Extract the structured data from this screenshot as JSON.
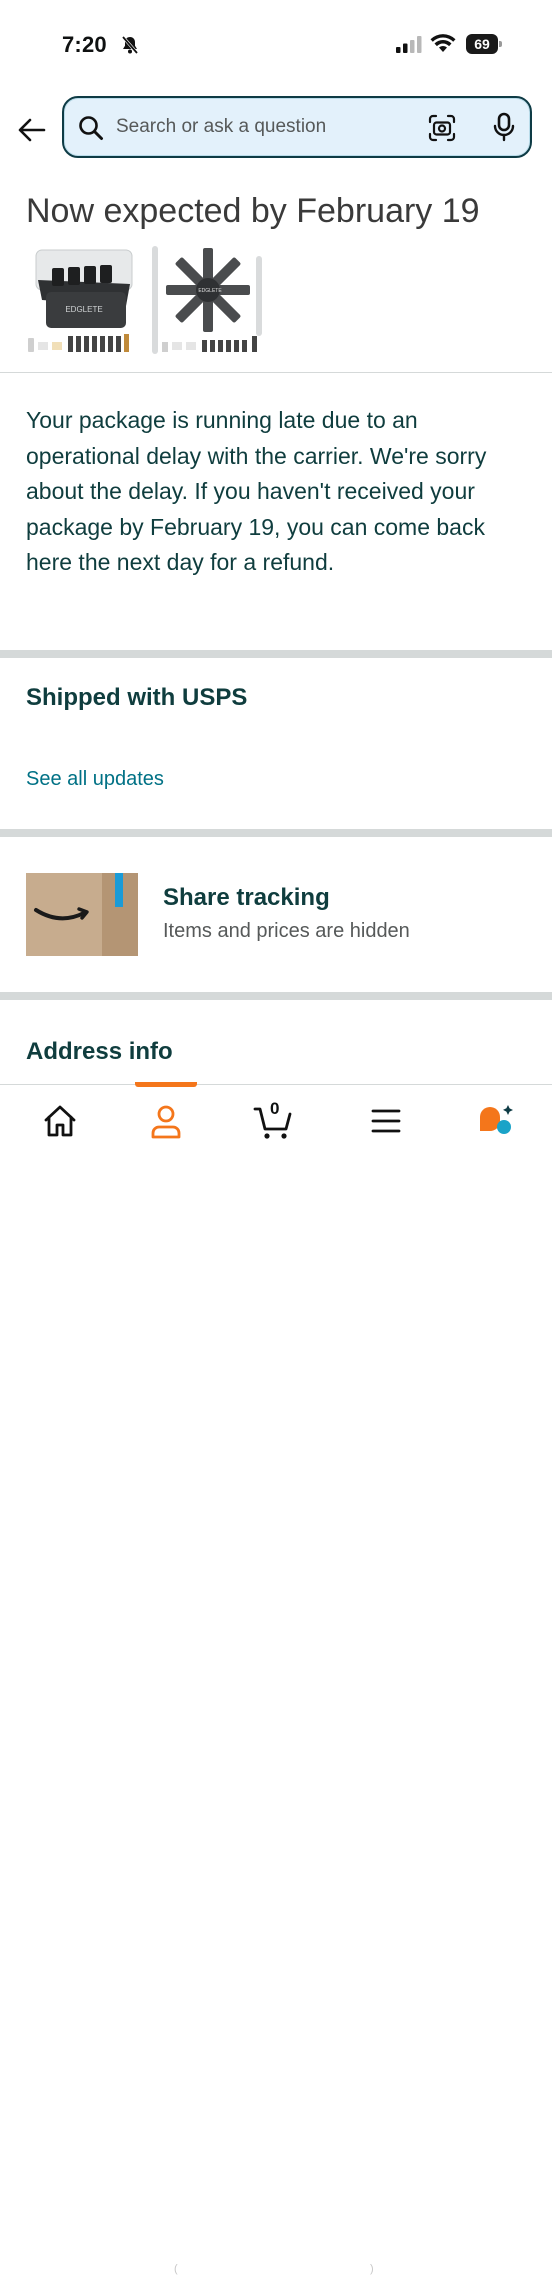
{
  "status_bar": {
    "time": "7:20",
    "battery": "69"
  },
  "search": {
    "placeholder": "Search or ask a question"
  },
  "delivery": {
    "title": "Now expected by February 19",
    "message": "Your package is running late due to an operational delay with the carrier. We're sorry about the delay. If you haven't received your package by February 19, you can come back here the next day for a refund.",
    "product_brand_1": "EDGLETE",
    "product_brand_2": "EDGLETE"
  },
  "shipping": {
    "title": "Shipped with USPS",
    "updates_link": "See all updates"
  },
  "share": {
    "title": "Share tracking",
    "subtitle": "Items and prices are hidden"
  },
  "address": {
    "title": "Address info"
  },
  "bottom_nav": {
    "cart_count": "0",
    "items": [
      "home-icon",
      "account-icon",
      "cart-icon",
      "menu-icon",
      "rufus-icon"
    ],
    "active": "account-icon"
  },
  "colors": {
    "accent_orange": "#f4761b",
    "link_teal": "#007185",
    "heading": "#0f3d3e",
    "search_bg": "#e3f1fb"
  }
}
